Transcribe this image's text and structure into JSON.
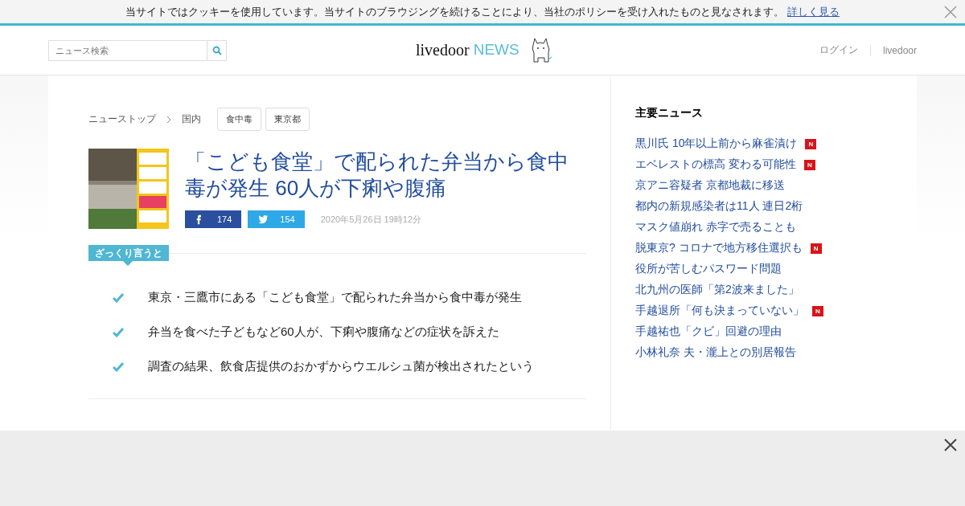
{
  "cookie_bar": {
    "message": "当サイトではクッキーを使用しています。当サイトのブラウジングを続けることにより、当社のポリシーを受け入れたものと見なされます。",
    "link": "詳しく見る"
  },
  "header": {
    "search": {
      "placeholder": "ニュース検索"
    },
    "logo": {
      "brand": "livedoor",
      "service": "NEWS"
    },
    "nav": [
      "ログイン",
      "livedoor"
    ]
  },
  "breadcrumb": [
    "ニューストップ",
    "国内"
  ],
  "tags": [
    "食中毒",
    "東京都"
  ],
  "article": {
    "title": "「こども食堂」で配られた弁当から食中毒が発生 60人が下痢や腹痛",
    "shares": [
      {
        "kind": "facebook",
        "count": "174"
      },
      {
        "kind": "twitter",
        "count": "154"
      }
    ],
    "date": "2020年5月26日 19時12分",
    "summary_label": "ざっくり言うと",
    "summary": [
      "東京・三鷹市にある「こども食堂」で配られた弁当から食中毒が発生",
      "弁当を食べた子どもなど60人が、下痢や腹痛などの症状を訴えた",
      "調査の結果、飲食店提供のおかずからウエルシュ菌が検出されたという"
    ]
  },
  "sidebar": {
    "title": "主要ニュース",
    "items": [
      {
        "text": "黒川氏 10年以上前から麻雀漬け",
        "badge": "N"
      },
      {
        "text": "エベレストの標高 変わる可能性",
        "badge": "N"
      },
      {
        "text": "京アニ容疑者 京都地裁に移送"
      },
      {
        "text": "都内の新規感染者は11人 連日2桁"
      },
      {
        "text": "マスク値崩れ 赤字で売ることも"
      },
      {
        "text": "脱東京? コロナで地方移住選択も",
        "badge": "N"
      },
      {
        "text": "役所が苦しむパスワード問題"
      },
      {
        "text": "北九州の医師「第2波来ました」"
      },
      {
        "text": "手越退所「何も決まっていない」",
        "badge": "N"
      },
      {
        "text": "手越祐也「クビ」回避の理由"
      },
      {
        "text": "小林礼奈 夫・瀧上との別居報告"
      }
    ]
  }
}
